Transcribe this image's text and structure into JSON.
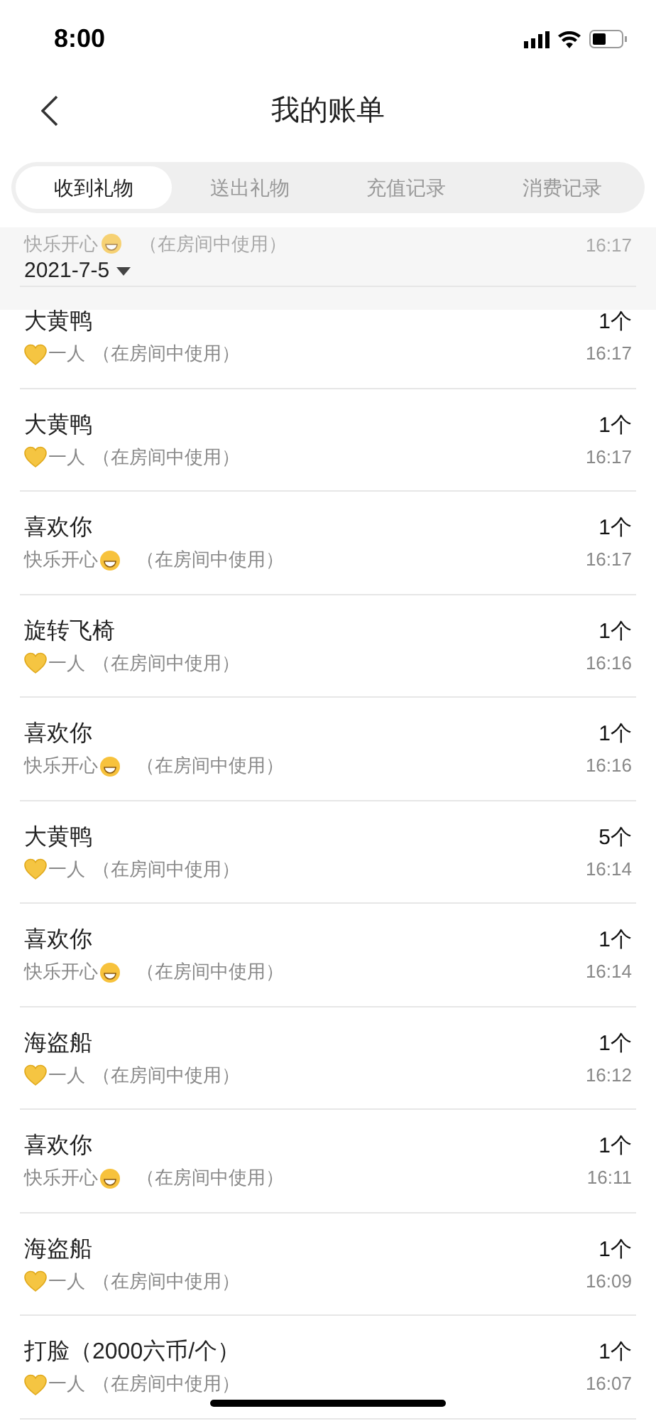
{
  "status_bar": {
    "time": "8:00"
  },
  "header": {
    "title": "我的账单"
  },
  "tabs": [
    {
      "label": "收到礼物",
      "selected": true
    },
    {
      "label": "送出礼物",
      "selected": false
    },
    {
      "label": "充值记录",
      "selected": false
    },
    {
      "label": "消费记录",
      "selected": false
    }
  ],
  "sticky_date": {
    "faded_row": {
      "sender": "快乐开心",
      "kind": "smile",
      "note": "（在房间中使用）",
      "time": "16:17"
    },
    "date": "2021-7-5"
  },
  "records": [
    {
      "gift": "大黄鸭",
      "sender": "一人",
      "kind": "heart",
      "note": "（在房间中使用）",
      "count": "1个",
      "time": "16:17"
    },
    {
      "gift": "大黄鸭",
      "sender": "一人",
      "kind": "heart",
      "note": "（在房间中使用）",
      "count": "1个",
      "time": "16:17"
    },
    {
      "gift": "喜欢你",
      "sender": "快乐开心",
      "kind": "smile",
      "note": "（在房间中使用）",
      "count": "1个",
      "time": "16:17"
    },
    {
      "gift": "旋转飞椅",
      "sender": "一人",
      "kind": "heart",
      "note": "（在房间中使用）",
      "count": "1个",
      "time": "16:16"
    },
    {
      "gift": "喜欢你",
      "sender": "快乐开心",
      "kind": "smile",
      "note": "（在房间中使用）",
      "count": "1个",
      "time": "16:16"
    },
    {
      "gift": "大黄鸭",
      "sender": "一人",
      "kind": "heart",
      "note": "（在房间中使用）",
      "count": "5个",
      "time": "16:14"
    },
    {
      "gift": "喜欢你",
      "sender": "快乐开心",
      "kind": "smile",
      "note": "（在房间中使用）",
      "count": "1个",
      "time": "16:14"
    },
    {
      "gift": "海盗船",
      "sender": "一人",
      "kind": "heart",
      "note": "（在房间中使用）",
      "count": "1个",
      "time": "16:12"
    },
    {
      "gift": "喜欢你",
      "sender": "快乐开心",
      "kind": "smile",
      "note": "（在房间中使用）",
      "count": "1个",
      "time": "16:11"
    },
    {
      "gift": "海盗船",
      "sender": "一人",
      "kind": "heart",
      "note": "（在房间中使用）",
      "count": "1个",
      "time": "16:09"
    },
    {
      "gift": "打脸（2000六币/个）",
      "sender": "一人",
      "kind": "heart",
      "note": "（在房间中使用）",
      "count": "1个",
      "time": "16:07"
    }
  ]
}
